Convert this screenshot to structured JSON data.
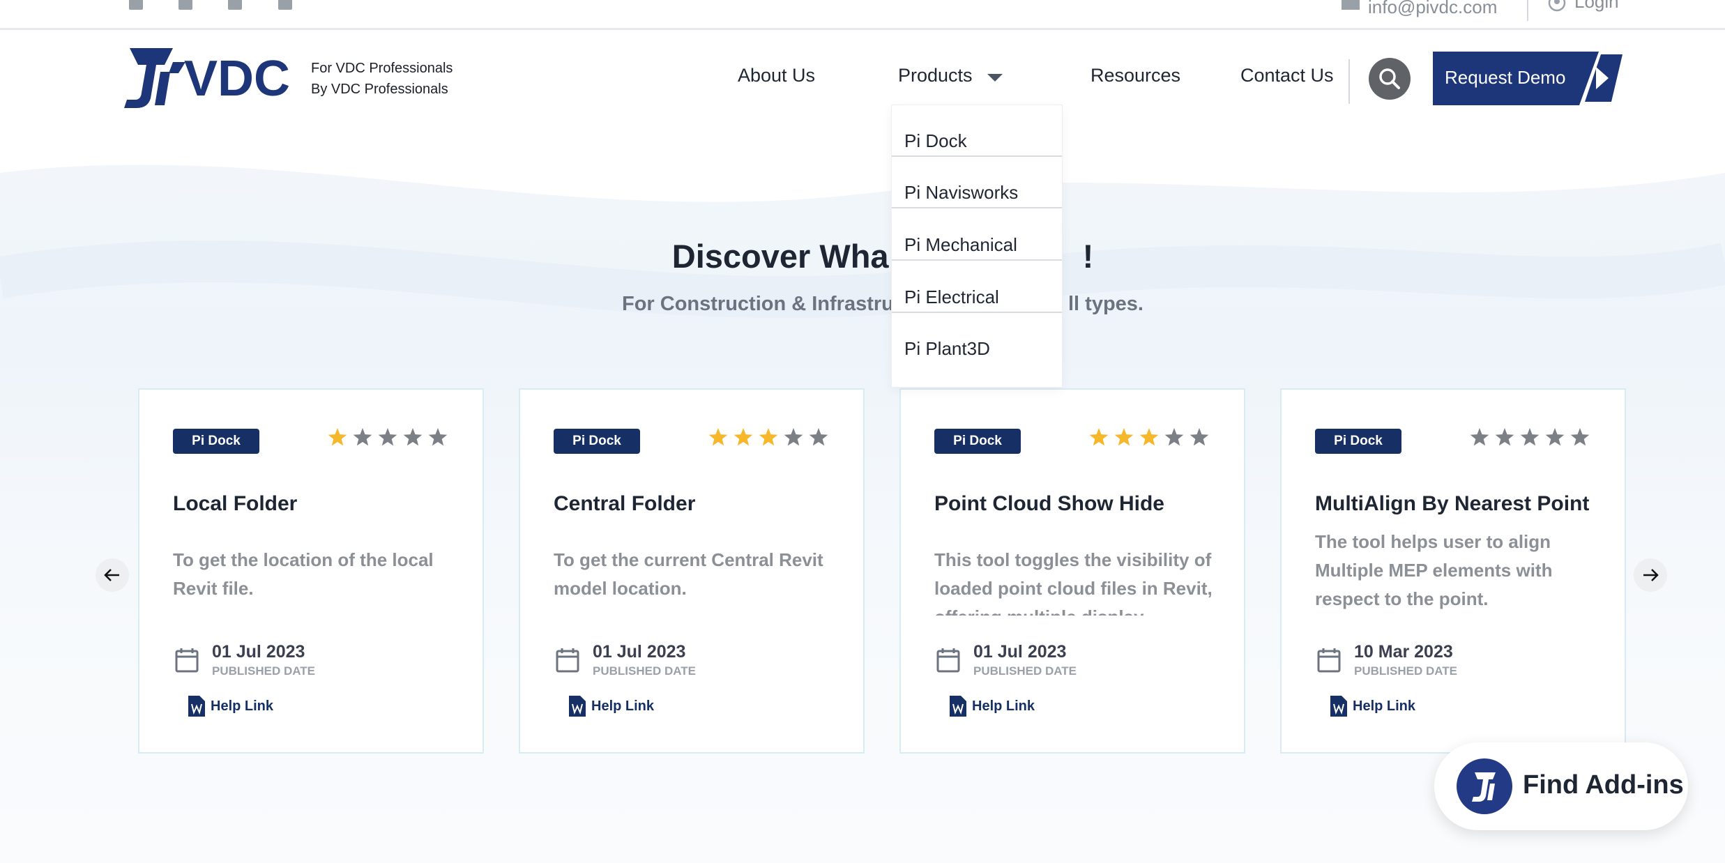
{
  "topbar": {
    "email": "info@pivdc.com",
    "login_label": "Login",
    "social_icons": [
      "linkedin-icon",
      "twitter-icon",
      "youtube-icon",
      "facebook-icon"
    ]
  },
  "brand": {
    "logo_text": "VDC",
    "tagline_line1": "For VDC Professionals",
    "tagline_line2": "By VDC Professionals",
    "primary_color": "#1d3579"
  },
  "nav": {
    "items": [
      {
        "label": "About Us"
      },
      {
        "label": "Products",
        "has_dropdown": true
      },
      {
        "label": "Resources"
      },
      {
        "label": "Contact Us"
      }
    ],
    "search_icon": "search-icon",
    "cta_label": "Request Demo"
  },
  "products_dropdown": {
    "open": true,
    "items": [
      "Pi Dock",
      "Pi Navisworks",
      "Pi Mechanical",
      "Pi Electrical",
      "Pi Plant3D"
    ]
  },
  "hero": {
    "title_visible": "Discover Wha",
    "title_tail": "!",
    "subtitle_visible": "For Construction & Infrastruc",
    "subtitle_tail": "ll types."
  },
  "cards": [
    {
      "badge": "Pi Dock",
      "rating": 1,
      "title": "Local Folder",
      "description": "To get the location of the local Revit file.",
      "date": "01 Jul 2023",
      "date_label": "PUBLISHED DATE",
      "help_label": "Help Link"
    },
    {
      "badge": "Pi Dock",
      "rating": 3,
      "title": "Central Folder",
      "description": "To get the current Central Revit model location.",
      "date": "01 Jul 2023",
      "date_label": "PUBLISHED DATE",
      "help_label": "Help Link"
    },
    {
      "badge": "Pi Dock",
      "rating": 3,
      "title": "Point Cloud Show Hide",
      "description": "This tool toggles the visibility of loaded point cloud files in Revit, offering multiple display options",
      "date": "01 Jul 2023",
      "date_label": "PUBLISHED DATE",
      "help_label": "Help Link"
    },
    {
      "badge": "Pi Dock",
      "rating": 0,
      "title": "MultiAlign By Nearest Point",
      "description": "The tool helps user to align Multiple MEP elements with respect to the point.",
      "date": "10 Mar 2023",
      "date_label": "PUBLISHED DATE",
      "help_label": "Help Link"
    }
  ],
  "rating_max": 5,
  "colors": {
    "star_filled": "#f6b72b",
    "star_empty": "#7b7f86",
    "badge_bg": "#163066"
  },
  "find_addins": {
    "label": "Find Add-ins"
  },
  "carousel": {
    "prev_icon": "arrow-left-icon",
    "next_icon": "arrow-right-icon"
  }
}
